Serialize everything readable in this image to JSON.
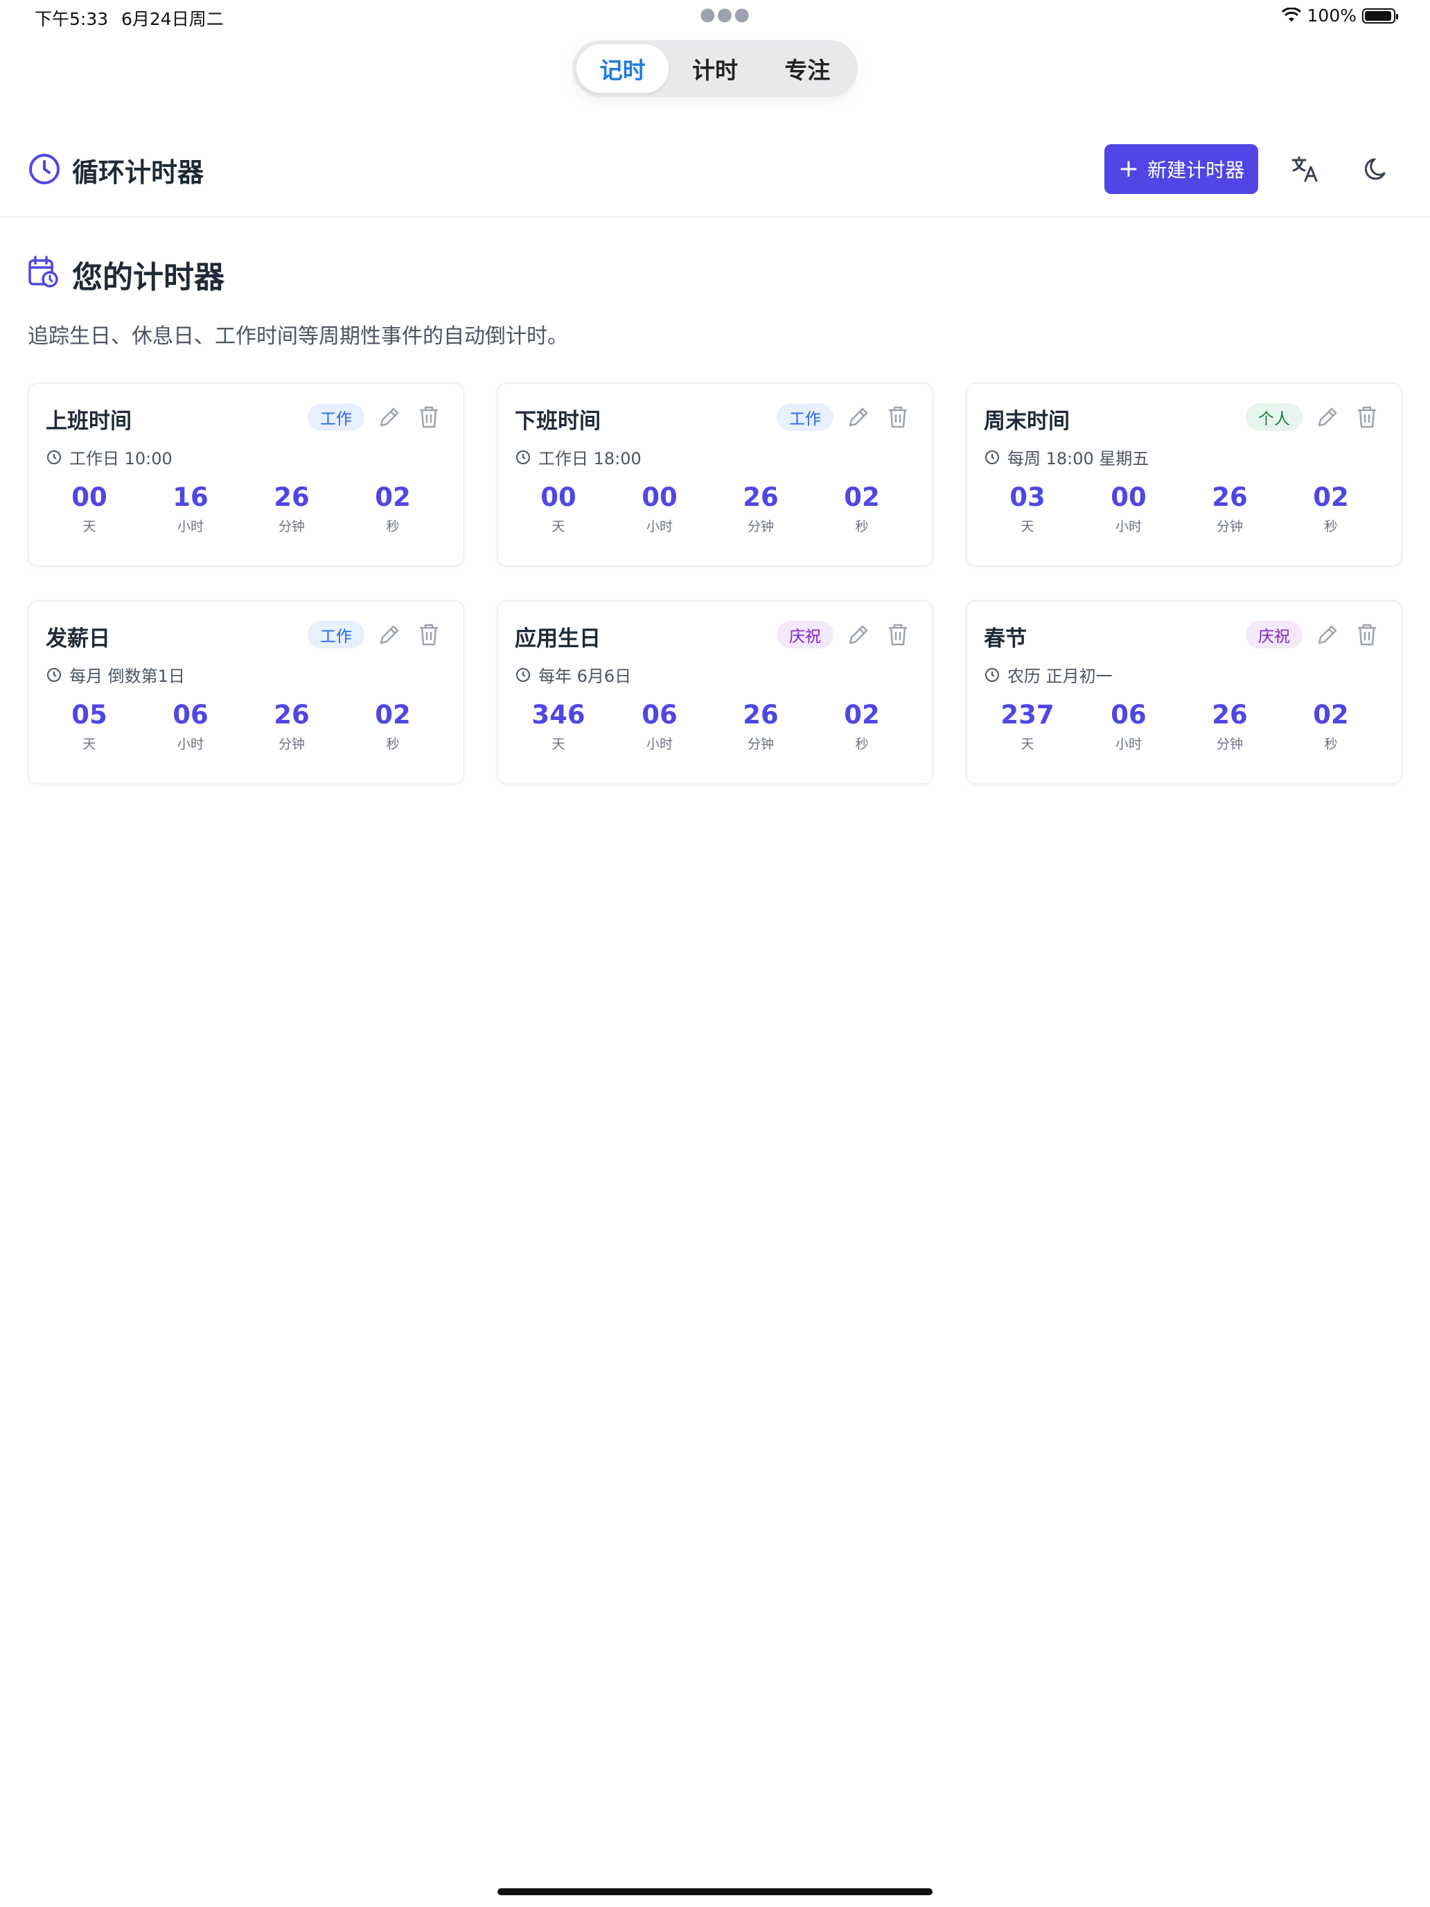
{
  "status_bar": {
    "time": "下午5:33",
    "date": "6月24日周二",
    "battery": "100%"
  },
  "tabs": [
    {
      "label": "记时",
      "active": true
    },
    {
      "label": "计时",
      "active": false
    },
    {
      "label": "专注",
      "active": false
    }
  ],
  "header": {
    "title": "循环计时器",
    "new_button": "新建计时器"
  },
  "section": {
    "title": "您的计时器",
    "description": "追踪生日、休息日、工作时间等周期性事件的自动倒计时。"
  },
  "unit_labels": {
    "days": "天",
    "hours": "小时",
    "minutes": "分钟",
    "seconds": "秒"
  },
  "timers": [
    {
      "name": "上班时间",
      "tag": "工作",
      "tag_type": "work",
      "schedule": "工作日 10:00",
      "days": "00",
      "hours": "16",
      "minutes": "26",
      "seconds": "02"
    },
    {
      "name": "下班时间",
      "tag": "工作",
      "tag_type": "work",
      "schedule": "工作日 18:00",
      "days": "00",
      "hours": "00",
      "minutes": "26",
      "seconds": "02"
    },
    {
      "name": "周末时间",
      "tag": "个人",
      "tag_type": "personal",
      "schedule": "每周 18:00 星期五",
      "days": "03",
      "hours": "00",
      "minutes": "26",
      "seconds": "02"
    },
    {
      "name": "发薪日",
      "tag": "工作",
      "tag_type": "work",
      "schedule": "每月 倒数第1日",
      "days": "05",
      "hours": "06",
      "minutes": "26",
      "seconds": "02"
    },
    {
      "name": "应用生日",
      "tag": "庆祝",
      "tag_type": "celebrate",
      "schedule": "每年 6月6日",
      "days": "346",
      "hours": "06",
      "minutes": "26",
      "seconds": "02"
    },
    {
      "name": "春节",
      "tag": "庆祝",
      "tag_type": "celebrate",
      "schedule": "农历 正月初一",
      "days": "237",
      "hours": "06",
      "minutes": "26",
      "seconds": "02"
    }
  ],
  "colors": {
    "accent": "#4f46e5",
    "tab_active": "#1f7ae0"
  }
}
